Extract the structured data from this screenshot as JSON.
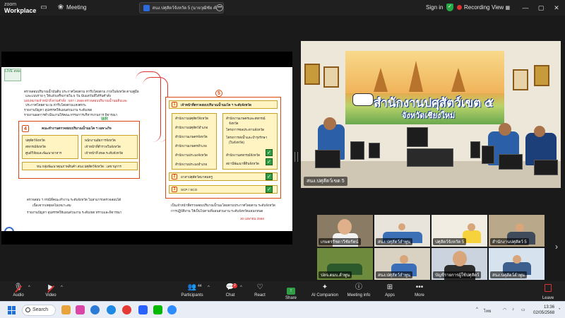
{
  "titlebar": {
    "brand_line1": "zoom",
    "brand_line2": "Workplace",
    "meeting_label": "Meeting",
    "share_pill_text": "สนง.ปศุสัตว์จังหวัด 5 (นายวุฒิชัย คำสี) ร5 ยิ",
    "signin": "Sign in",
    "recording": "Recording",
    "view": "View",
    "colors": {
      "shield": "#28a745",
      "recording_dot": "#e03131",
      "share_square": "#2d6cdf"
    }
  },
  "slide": {
    "brand_text": "LIVE สพล",
    "bullets_top": [
      "ตรวจสอบปริมาณน้ำมันดิบ ประกาศโดยตาม ห่ารีบโดยตาม ภายในจังหวัด ตามคู่มือ",
      "และแบบราย ๆ ให้แล้วเสร็จภายใน 5 วัน นับแต่วันที่ได้รับคำสั่ง",
      "มอบหมายเจ้าหน้าที่ ตามคำสั่ง : 507 / 2568 ตรวจสอบปริมาณน้ำนมดิบและ",
      "ประกาศโดยตาม ณ ห่ารีบโดยตามแหงศกระ",
      "รายงานปัญหา อุปสรรคให้แผนส่วนงาน ระดับเขต",
      "รายงานผลการดำเนินงานให้คณะกรรมการบริหารงานการ พิจารณา"
    ],
    "wr_label": "WR",
    "box4": {
      "num": "4",
      "header": "คณะทำงานตรวจสอบปริมาณน้ำนมโค ฯ  เฉพาะกิจ",
      "left_items": [
        "ปศุสัตว์จังหวัด",
        "สหกรณ์จังหวัด",
        "ศูนย์วิจัยและพัฒนาอาหาร"
      ],
      "right_items": [
        "พนักงานอัยการจังหวัด",
        "เจ้าหน้าที่ตำรวจในจังหวัด",
        "เจ้าหน้าที่ สพล.ระดับจังหวัด"
      ],
      "footer": "หน.กลุ่มพัฒนาคุณภาพสินค้า  สนง.ปศุสัตว์จังหวัด : เลขานุการ"
    },
    "bullets_bottom": [
      "ตรวจสอบ ฯ กรณีที่คณะทำงาน ระดับจังหวัด ไม่สามารถตรวจสอบได้",
      "เนื่องจากเหตุผลไม่เหมาะสม",
      "รายงานปัญหา อุปสรรคให้แผนส่วนงาน ระดับเขต ทราบและพิจารณา"
    ],
    "box5": {
      "num": "5",
      "item1_num": "1",
      "item1_header": "เจ้าหน้าที่ตรวจสอบปริมาณน้ำนมโค ฯ  ระดับจังหวัด",
      "left_items": [
        "สำนักงานปศุสัตว์จังหวัด",
        "สำนักงานปศุสัตว์อำเภอ",
        "สำนักงานเกษตรจังหวัด",
        "สำนักงานเกษตรอำเภอ",
        "สำนักงานประมงจังหวัด",
        "สำนักงานประมงอำเภอ"
      ],
      "right_items": [
        "สำนักงานเกษตรและสหกรณ์",
        "จังหวัด",
        "โครงการชลประทานจังหวัด",
        "โครงการส่งน้ำและบำรุงรักษา",
        "(ในจังหวัด)",
        "สำนักงานสหกรณ์จังหวัด",
        "สถานีพัฒนาที่ดินจังหวัด"
      ],
      "item2_num": "2",
      "item2": "อาสาปศุสัตว์สมาคมครู",
      "item3_num": "3",
      "item3": "SCP / SCO"
    },
    "bullets_right": [
      "เป็นเจ้าหน้าที่ตรวจสอบปริมาณน้ำนมโดยตามประกาศโดยตาม ระดับจังหวัด",
      "การปฏิบัติงาน ให้เป็นไปตามที่แผนส่วนงาน ระดับจังหวัดแผนกหนด"
    ],
    "date": "30 เมษายน 2568",
    "check_glyph": "✓"
  },
  "video_main": {
    "banner_title": "สำนักงานปศุสัตว์เขต ๕",
    "banner_subtitle": "จังหวัดเชียงใหม่",
    "participant_label": "สนง.ปศุสัตว์เขต 5"
  },
  "gallery": {
    "tiles": [
      {
        "label": "เกษตรรัชดาวิชัยรัตน์"
      },
      {
        "label": "สนง.ปศุสัตว์ลำพูน"
      },
      {
        "label": "ปศุสัตว์จังหวัด 5"
      },
      {
        "label": "สำนักงานปศุสัตว์ 5"
      },
      {
        "label": "ปลจ.ตมบ.ลำพูน"
      },
      {
        "label": "สนง.ปศุสัตว์ลำพูน"
      },
      {
        "label": "บัญชีรายการผู้ใช้ปศุสัตว์"
      },
      {
        "label": "สนง.ปศุสัตว์ลำพูน"
      }
    ],
    "next_icon": "chevron-right-icon"
  },
  "toolbar": {
    "audio": "Audio",
    "video": "Video",
    "participants": "Participants",
    "participants_count": "44",
    "chat": "Chat",
    "chat_badge": "2",
    "react": "React",
    "share": "Share",
    "ai_companion": "AI Companion",
    "meeting_info": "Meeting info",
    "apps": "Apps",
    "more": "More",
    "leave": "Leave",
    "colors": {
      "share": "#2f9e44",
      "leave": "#e03131",
      "muted": "#e03131"
    }
  },
  "taskbar": {
    "search_label": "Search",
    "tray_lang": "ไทย",
    "time": "13:36",
    "date": "02/05/2568",
    "app_colors": [
      "#e8a33d",
      "#d946a6",
      "#2b7bd6",
      "#1e88e5",
      "#2ea44f",
      "#e53935",
      "#2962ff",
      "#00b900",
      "#f4b400",
      "#2d8cff"
    ]
  }
}
